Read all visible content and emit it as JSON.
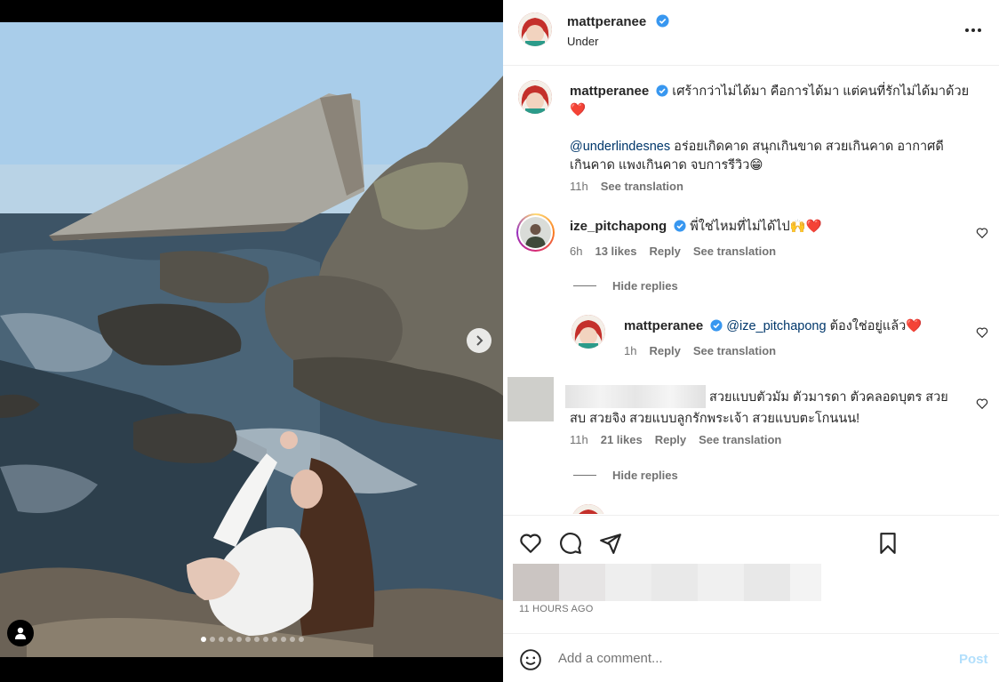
{
  "post": {
    "username": "mattperanee",
    "location": "Under",
    "carousel_index": 1,
    "carousel_count": 12
  },
  "caption": {
    "username": "mattperanee",
    "text_line1": "เศร้ากว่าไม่ได้มา คือการได้มา แต่คนที่รักไม่ได้มาด้วย",
    "emoji_line1": "❤️",
    "mention": "@underlindesnes",
    "text_line2": " อร่อยเกิดคาด สนุกเกินขาด สวยเกินคาด อากาศดี",
    "text_line3": "เกินคาด แพงเกินคาด จบการรีวิว",
    "emoji_line3": "😁",
    "time": "11h",
    "see_translation": "See translation"
  },
  "comments": [
    {
      "username": "ize_pitchapong",
      "text": "พี่ใช่ไหมที่ไม่ได้ไป",
      "emoji": "🙌❤️",
      "time": "6h",
      "likes": "13 likes",
      "reply": "Reply",
      "see_translation": "See translation",
      "hide_replies": "Hide replies",
      "replies": [
        {
          "username": "mattperanee",
          "mention": "@ize_pitchapong",
          "text": " ต้องใช่อยู่แล้ว",
          "emoji": "❤️",
          "time": "1h",
          "reply": "Reply",
          "see_translation": "See translation"
        }
      ]
    },
    {
      "username": "",
      "text_line1": "สวยแบบตัวมัม ตัวมารดา ตัวคลอดบุตร สวย",
      "text_line2": "สบ สวยจิง สวยแบบลูกรักพระเจ้า สวยแบบตะโกนนน!",
      "time": "11h",
      "likes": "21 likes",
      "reply": "Reply",
      "see_translation": "See translation",
      "hide_replies": "Hide replies"
    }
  ],
  "actions": {
    "like_icon": "heart-icon",
    "comment_icon": "comment-icon",
    "share_icon": "paper-plane-icon",
    "save_icon": "bookmark-icon",
    "posted_time": "11 HOURS AGO"
  },
  "composer": {
    "placeholder": "Add a comment...",
    "post_label": "Post",
    "emoji_icon": "smiley-icon"
  },
  "colors": {
    "verified": "#3897f0",
    "link": "#00376b",
    "post_disabled": "#b2dffc",
    "heart_red": "#ed1c24"
  }
}
